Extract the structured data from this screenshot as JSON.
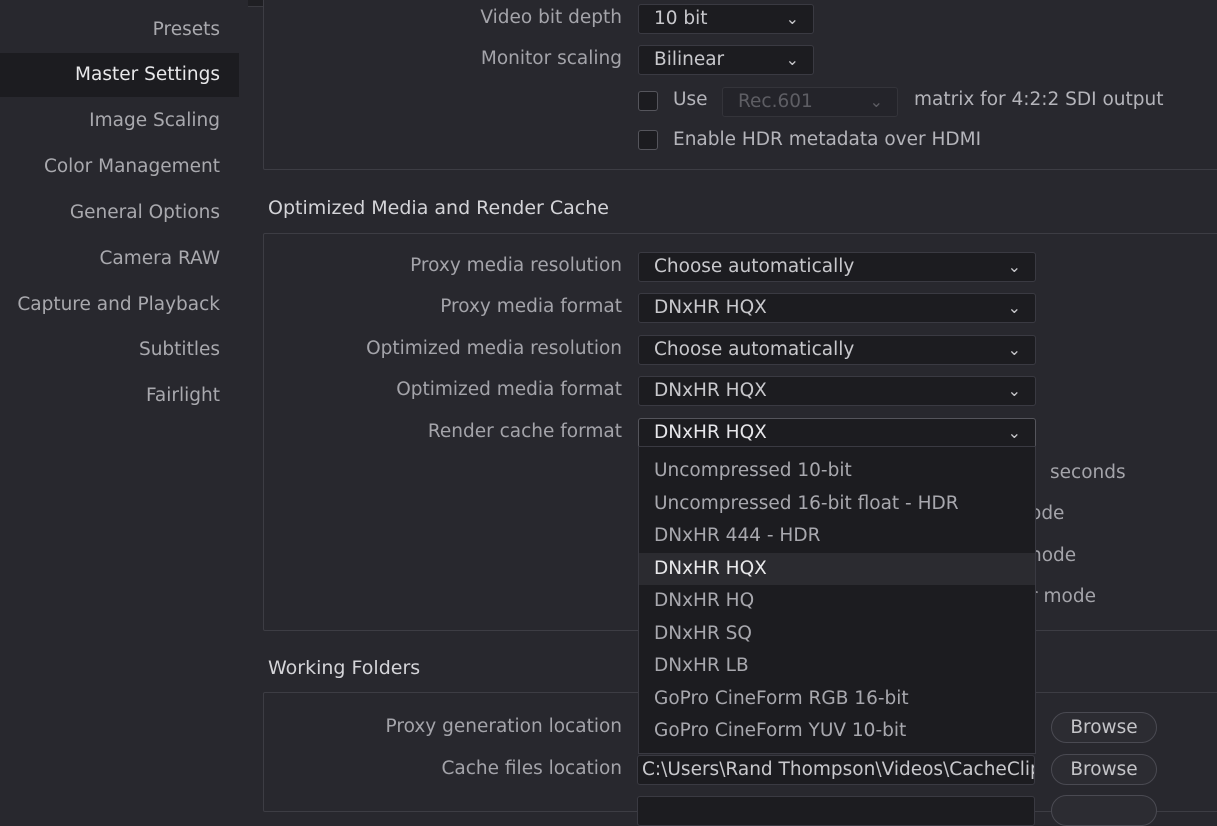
{
  "sidebar": {
    "items": [
      {
        "label": "Presets"
      },
      {
        "label": "Master Settings"
      },
      {
        "label": "Image Scaling"
      },
      {
        "label": "Color Management"
      },
      {
        "label": "General Options"
      },
      {
        "label": "Camera RAW"
      },
      {
        "label": "Capture and Playback"
      },
      {
        "label": "Subtitles"
      },
      {
        "label": "Fairlight"
      }
    ],
    "active_index": 1
  },
  "video_monitoring": {
    "bit_depth_label": "Video bit depth",
    "bit_depth_value": "10 bit",
    "monitor_scaling_label": "Monitor scaling",
    "monitor_scaling_value": "Bilinear",
    "use_label": "Use",
    "matrix_value": "Rec.601",
    "matrix_suffix": "matrix for 4:2:2 SDI output",
    "hdr_label": "Enable HDR metadata over HDMI"
  },
  "optimized": {
    "title": "Optimized Media and Render Cache",
    "proxy_res_label": "Proxy media resolution",
    "proxy_res_value": "Choose automatically",
    "proxy_format_label": "Proxy media format",
    "proxy_format_value": "DNxHR HQX",
    "opt_res_label": "Optimized media resolution",
    "opt_res_value": "Choose automatically",
    "opt_format_label": "Optimized media format",
    "opt_format_value": "DNxHR HQX",
    "render_cache_label": "Render cache format",
    "render_cache_value": "DNxHR HQX",
    "partial_seconds": "seconds",
    "partial_mode1": "ode",
    "partial_mode2": "node",
    "partial_mode3": "r mode"
  },
  "render_cache_menu": {
    "options": [
      "Uncompressed 10-bit",
      "Uncompressed 16-bit float - HDR",
      "DNxHR 444 - HDR",
      "DNxHR HQX",
      "DNxHR HQ",
      "DNxHR SQ",
      "DNxHR LB",
      "GoPro CineForm RGB 16-bit",
      "GoPro CineForm YUV 10-bit"
    ],
    "selected_index": 3
  },
  "working_folders": {
    "title": "Working Folders",
    "proxy_location_label": "Proxy generation location",
    "cache_location_label": "Cache files location",
    "cache_location_value": "C:\\Users\\Rand Thompson\\Videos\\CacheClip",
    "browse_label": "Browse"
  },
  "icons": {
    "chevron": "chevron-down-icon"
  }
}
